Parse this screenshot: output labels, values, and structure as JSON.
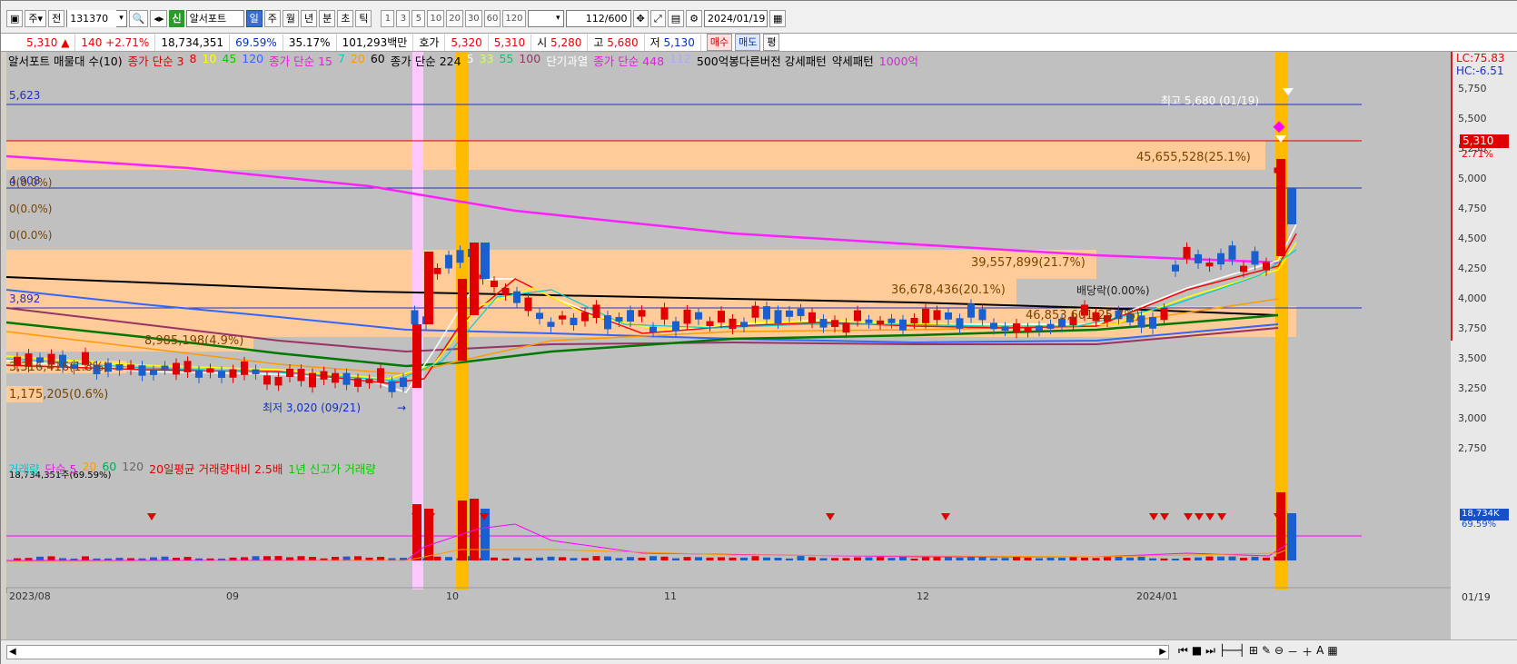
{
  "toolbar": {
    "period_label": "주",
    "prev_label": "전",
    "code": "131370",
    "credit_badge": "신",
    "stock_name": "알서포트",
    "periods": [
      "일",
      "주",
      "월",
      "년",
      "분",
      "초",
      "틱"
    ],
    "minutes": [
      "1",
      "3",
      "5",
      "10",
      "20",
      "30",
      "60",
      "120"
    ],
    "count": "112",
    "total": "/600",
    "date": "2024/01/19"
  },
  "quote": {
    "price": "5,310",
    "arrow": "▲",
    "change": "140",
    "rate": "+2.71%",
    "volume": "18,734,351",
    "vol_ratio": "69.59%",
    "turnover": "35.17%",
    "amount": "101,293백만",
    "ask_label": "호가",
    "ask": "5,320",
    "bid": "5,310",
    "open_label": "시",
    "open": "5,280",
    "high_label": "고",
    "high": "5,680",
    "low_label": "저",
    "low": "5,130",
    "buy_label": "매수",
    "sell_label": "매도",
    "flat_label": "평"
  },
  "legend": {
    "items": [
      {
        "text": "알서포트 매물대 수(10)",
        "color": "#000000"
      },
      {
        "text": "종가 단순 3",
        "color": "#e00000"
      },
      {
        "text": "8",
        "color": "#e00000"
      },
      {
        "text": "10",
        "color": "#ffff00"
      },
      {
        "text": "45",
        "color": "#00cc00"
      },
      {
        "text": "120",
        "color": "#3366ff"
      },
      {
        "text": "종가 단순 15",
        "color": "#e020e0"
      },
      {
        "text": "7",
        "color": "#00cccc"
      },
      {
        "text": "20",
        "color": "#ff9900"
      },
      {
        "text": "60",
        "color": "#000000"
      },
      {
        "text": "종가 단순 224",
        "color": "#000000"
      },
      {
        "text": "5",
        "color": "#ffffff"
      },
      {
        "text": "33",
        "color": "#ccff66"
      },
      {
        "text": "55",
        "color": "#00cc66"
      },
      {
        "text": "100",
        "color": "#993366"
      },
      {
        "text": "단기과열",
        "color": "#ffffff"
      },
      {
        "text": "종가 단순 448",
        "color": "#e020e0"
      },
      {
        "text": "112",
        "color": "#aaaaff"
      },
      {
        "text": "500억봉다른버전 강세패턴",
        "color": "#000000"
      },
      {
        "text": "약세패턴",
        "color": "#000000"
      },
      {
        "text": "1000억",
        "color": "#e020e0"
      }
    ]
  },
  "price_axis": {
    "ticks": [
      "5,750",
      "5,500",
      "5,250",
      "5,000",
      "4,750",
      "4,500",
      "4,250",
      "4,000",
      "3,750",
      "3,500",
      "3,250",
      "3,000",
      "2,750"
    ],
    "lc": "LC:75.83",
    "hc": "HC:-6.51",
    "current": "5,310",
    "current_rate": "2.71%"
  },
  "annotations": {
    "level_top": "5,623",
    "level_mid": "4,908",
    "level_low": "3,892",
    "high_note": "최고 5,680 (01/19)",
    "low_note": "최저 3,020 (09/21)",
    "dividend": "배당락(0.00%)",
    "pct0a": "0(0.0%)",
    "pct0b": "0(0.0%)",
    "pct0c": "0(0.0%)",
    "band1": "45,655,528(25.1%)",
    "band2": "39,557,899(21.7%)",
    "band3": "36,678,436(20.1%)",
    "band4": "46,853,601(25.7%)",
    "band5": "8,985,198(4.9%)",
    "band6": "3,316,416(1.8%)",
    "band7": "1,175,205(0.6%)"
  },
  "volume_panel": {
    "legend": [
      {
        "text": "거래량",
        "color": "#00cccc"
      },
      {
        "text": "단순 5",
        "color": "#e020e0"
      },
      {
        "text": "20",
        "color": "#ff9900"
      },
      {
        "text": "60",
        "color": "#00aa55"
      },
      {
        "text": "120",
        "color": "#666666"
      },
      {
        "text": "20일평균 거래량대비 2.5배",
        "color": "#e00000"
      },
      {
        "text": "1년 신고가 거래량",
        "color": "#00cc00"
      }
    ],
    "current": "18,734,351주(69.59%)",
    "axis_value": "18,734K",
    "axis_rate": "69.59%"
  },
  "time_axis": {
    "labels": [
      "2023/08",
      "09",
      "10",
      "11",
      "12",
      "2024/01"
    ],
    "right_label": "01/19"
  }
}
